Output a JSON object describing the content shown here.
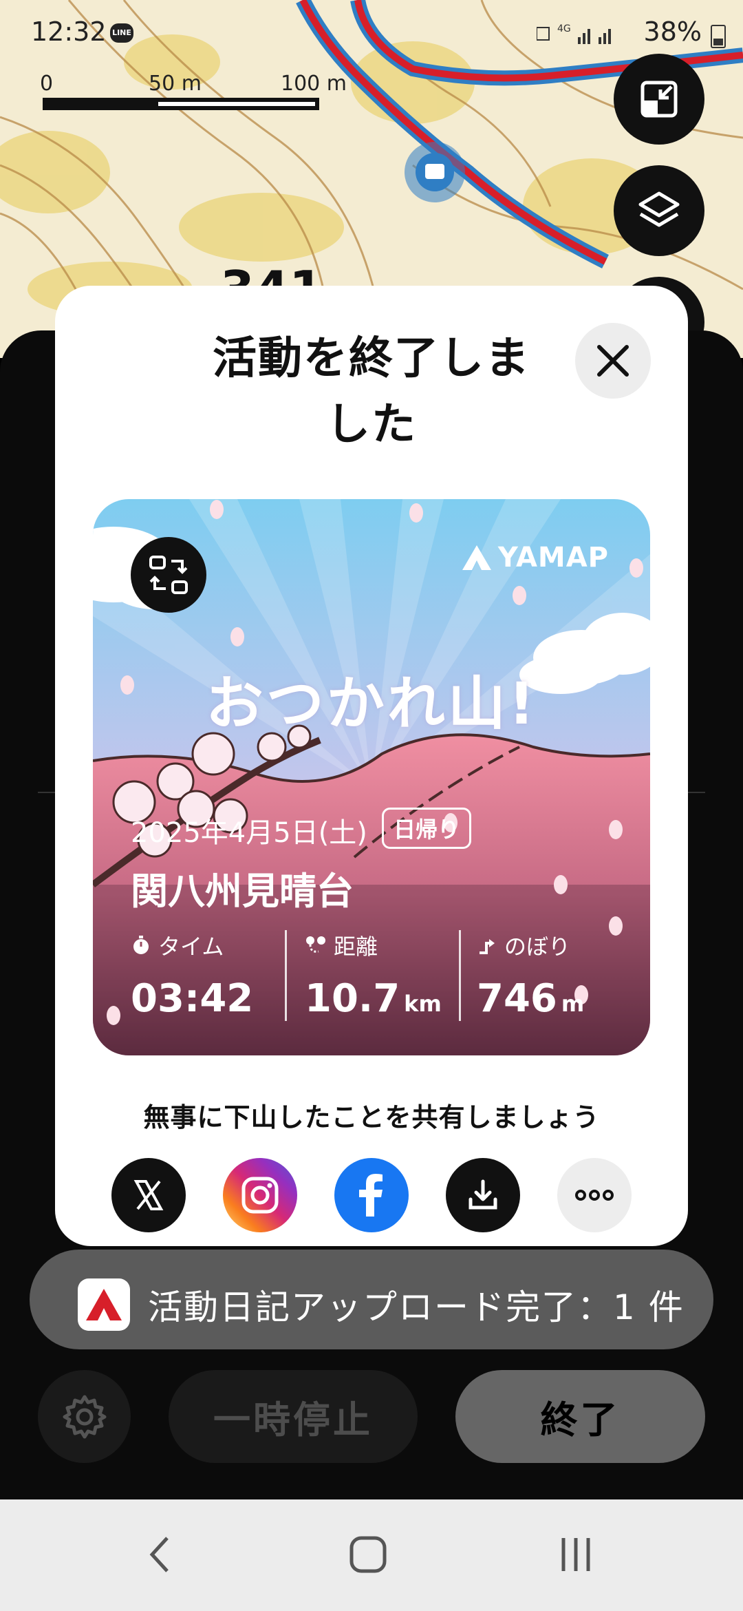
{
  "status_bar": {
    "time": "12:32",
    "line_badge": "LINE",
    "battery": "38%"
  },
  "map": {
    "scale_labels": [
      "0",
      "50 m",
      "100 m"
    ]
  },
  "modal": {
    "title": "活動を終了しました",
    "card": {
      "headline": "おつかれ山!",
      "brand": "YAMAP",
      "date": "2025年4月5日(土)",
      "trip_type": "日帰り",
      "place": "関八州見晴台",
      "stats": [
        {
          "label": "タイム",
          "value": "03:42",
          "unit": ""
        },
        {
          "label": "距離",
          "value": "10.7",
          "unit": "km"
        },
        {
          "label": "のぼり",
          "value": "746",
          "unit": "m"
        }
      ]
    },
    "share_prompt": "無事に下山したことを共有しましょう"
  },
  "toast": {
    "text": "活動日記アップロード完了：1 件"
  },
  "controls": {
    "pause_label": "一時停止",
    "end_label": "終了"
  },
  "colors": {
    "route_red": "#d71f2a",
    "route_blue": "#2f7ec4",
    "toast_bg": "#5b5b5b",
    "instagram": "#e1306c",
    "facebook": "#1877f2"
  }
}
